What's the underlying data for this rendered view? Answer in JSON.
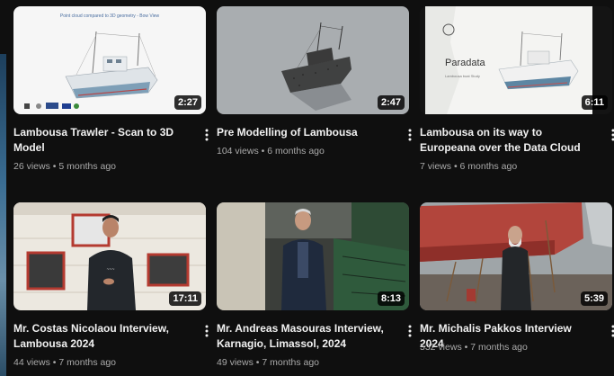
{
  "videos": [
    {
      "title": "Lambousa Trawler - Scan to 3D Model",
      "views": "26 views",
      "age": "5 months ago",
      "duration": "2:27",
      "thumb_caption": "Point cloud compared to 3D geometry - Bow View"
    },
    {
      "title": "Pre Modelling of Lambousa",
      "views": "104 views",
      "age": "6 months ago",
      "duration": "2:47"
    },
    {
      "title": "Lambousa on its way to Europeana over the Data Cloud on Cultural…",
      "views": "7 views",
      "age": "6 months ago",
      "duration": "6:11",
      "thumb_heading": "Paradata",
      "thumb_sub": "Lambousa boat Study"
    },
    {
      "title": "Mr. Costas Nicolaou Interview, Lambousa 2024",
      "views": "44 views",
      "age": "7 months ago",
      "duration": "17:11"
    },
    {
      "title": "Mr. Andreas Masouras Interview, Karnagio, Limassol, 2024",
      "views": "49 views",
      "age": "7 months ago",
      "duration": "8:13"
    },
    {
      "title": "Mr. Michalis Pakkos Interview 2024",
      "views": "532 views",
      "age": "7 months ago",
      "duration": "5:39"
    }
  ],
  "meta_separator": "•",
  "icons": {
    "more": "more-vert-icon"
  },
  "colors": {
    "background": "#0f0f0f",
    "meta_text": "#aaaaaa",
    "title_text": "#f1f1f1"
  }
}
